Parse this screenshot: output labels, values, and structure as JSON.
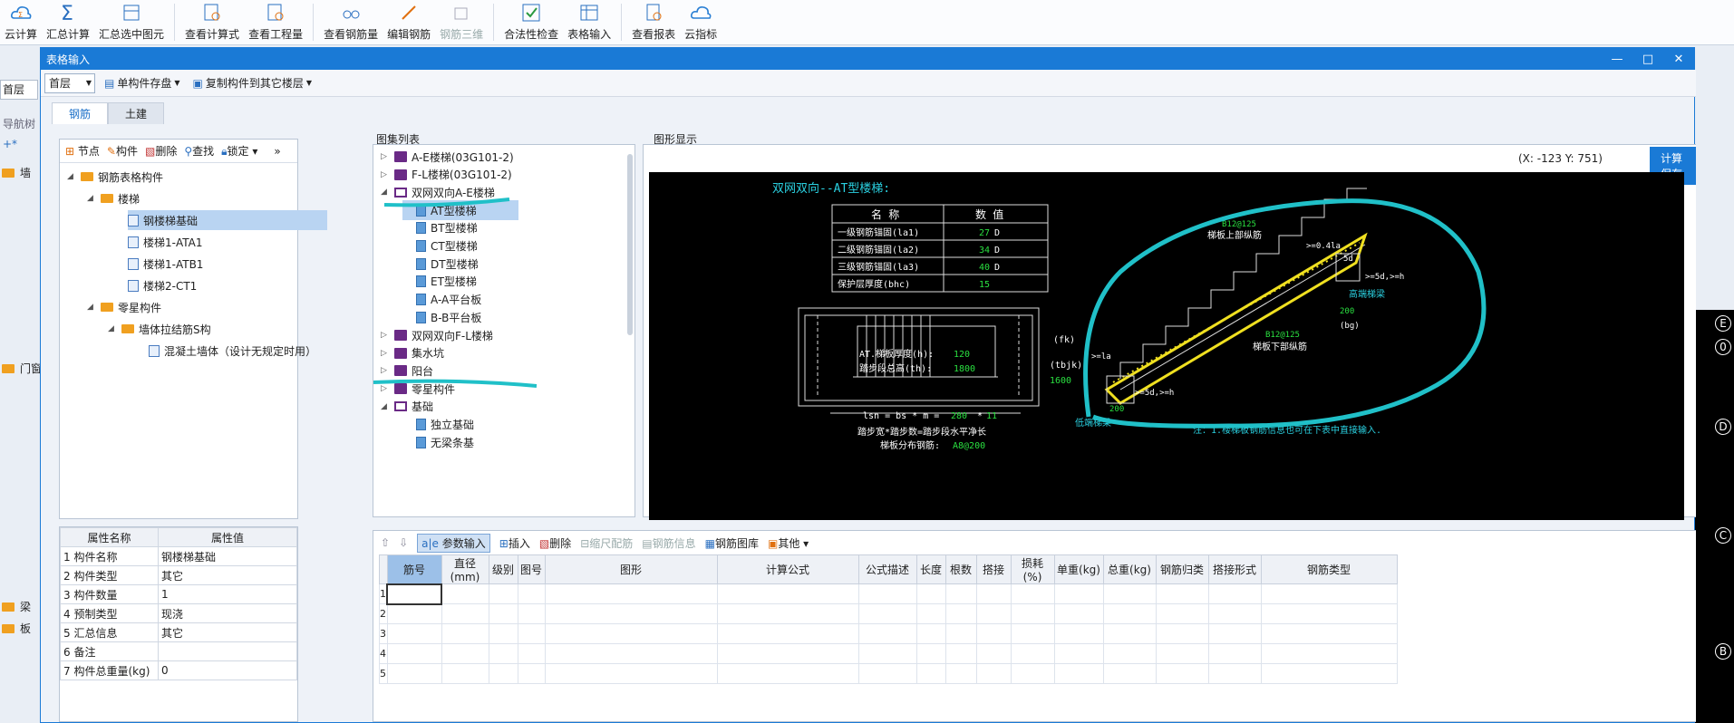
{
  "ribbon": [
    {
      "label": "云计算",
      "icon": "cloud-calc-icon"
    },
    {
      "label": "汇总计算",
      "icon": "sigma-icon"
    },
    {
      "label": "汇总选中图元",
      "icon": "sum-selected-icon"
    },
    {
      "label": "查看计算式",
      "icon": "view-formula-icon"
    },
    {
      "label": "查看工程量",
      "icon": "view-quantity-icon"
    },
    {
      "label": "查看钢筋量",
      "icon": "view-rebar-icon"
    },
    {
      "label": "编辑钢筋",
      "icon": "edit-rebar-icon"
    },
    {
      "label": "钢筋三维",
      "icon": "rebar-3d-icon"
    },
    {
      "label": "合法性检查",
      "icon": "check-icon"
    },
    {
      "label": "表格输入",
      "icon": "table-input-icon"
    },
    {
      "label": "查看报表",
      "icon": "report-icon"
    },
    {
      "label": "云指标",
      "icon": "cloud-index-icon"
    }
  ],
  "window": {
    "title": "表格输入"
  },
  "floor_outer": "首层",
  "toolbar2": {
    "floor": "首层",
    "save_single": "单构件存盘",
    "copy": "复制构件到其它楼层"
  },
  "tabs": [
    "钢筋",
    "土建"
  ],
  "leftnav": {
    "title": "导航树",
    "items": [
      "墙",
      "门窗",
      "梁",
      "板"
    ]
  },
  "treeToolbar": {
    "node": "节点",
    "component": "构件",
    "delete": "删除",
    "find": "查找",
    "lock": "锁定"
  },
  "tree": [
    "钢筋表格构件",
    "楼梯",
    "钢楼梯基础",
    "楼梯1-ATA1",
    "楼梯1-ATB1",
    "楼梯2-CT1",
    "零星构件",
    "墙体拉结筋S构",
    "混凝土墙体（设计无规定时用）"
  ],
  "props": {
    "h_name": "属性名称",
    "h_value": "属性值",
    "rows": [
      {
        "n": "1",
        "k": "构件名称",
        "v": "钢楼梯基础"
      },
      {
        "n": "2",
        "k": "构件类型",
        "v": "其它"
      },
      {
        "n": "3",
        "k": "构件数量",
        "v": "1"
      },
      {
        "n": "4",
        "k": "预制类型",
        "v": "现浇"
      },
      {
        "n": "5",
        "k": "汇总信息",
        "v": "其它"
      },
      {
        "n": "6",
        "k": "备注",
        "v": ""
      },
      {
        "n": "7",
        "k": "构件总重量(kg)",
        "v": "0"
      }
    ]
  },
  "atlas": {
    "title": "图集列表",
    "items": [
      "A-E楼梯(03G101-2)",
      "F-L楼梯(03G101-2)",
      "双网双向A-E楼梯",
      "AT型楼梯",
      "BT型楼梯",
      "CT型楼梯",
      "DT型楼梯",
      "ET型楼梯",
      "A-A平台板",
      "B-B平台板",
      "双网双向F-L楼梯",
      "集水坑",
      "阳台",
      "零星构件",
      "基础",
      "独立基础",
      "无梁条基"
    ]
  },
  "graphic": {
    "title": "图形显示",
    "coord": "(X: -123 Y: 751)",
    "save": "计算保存"
  },
  "cad": {
    "heading": "双网双向--AT型楼梯:",
    "t_h1": "名 称",
    "t_h2": "数 值",
    "rows": [
      {
        "k": "一级钢筋锚固(la1)",
        "v": "27",
        "u": "D"
      },
      {
        "k": "二级钢筋锚固(la2)",
        "v": "34",
        "u": "D"
      },
      {
        "k": "三级钢筋锚固(la3)",
        "v": "40",
        "u": "D"
      },
      {
        "k": "保护层厚度(bhc)",
        "v": "15",
        "u": ""
      }
    ],
    "thick": "AT.梯板厚度(h):",
    "thick_v": "120",
    "height": "踏步段总高(th):",
    "height_v": "1800",
    "fk": "(fk)",
    "tbjk": "(tbjk)",
    "v1600": "1600",
    "lsn": "lsn = bs * m =",
    "bs": "280",
    "m": "11",
    "steps": "踏步宽*踏步数=踏步段水平净长",
    "dist": "梯板分布钢筋:",
    "dist_v": "A8@200",
    "b1": "B12@125",
    "top": "梯板上部纵筋",
    "b2": "B12@125",
    "bot": "梯板下部纵筋",
    "high": "高端梯梁",
    "low": "低端梯梁",
    "v200a": "200",
    "v200b": "200",
    "bg": "(bg)",
    "note": "注：1.楼梯板钢筋信息也可在下表中直接输入.",
    "l1": ">=0.4la",
    "l2": "5d",
    ">5d": ">=5d,>=h",
    "l3": ">=la",
    "l4": ">=5d,>=h"
  },
  "gridTb": {
    "param": "参数输入",
    "insert": "插入",
    "delete": "删除",
    "scale": "缩尺配筋",
    "info": "钢筋信息",
    "lib": "钢筋图库",
    "other": "其他"
  },
  "gridHead": [
    "筋号",
    "直径(mm)",
    "级别",
    "图号",
    "图形",
    "计算公式",
    "公式描述",
    "长度",
    "根数",
    "搭接",
    "损耗(%)",
    "单重(kg)",
    "总重(kg)",
    "钢筋归类",
    "搭接形式",
    "钢筋类型"
  ],
  "gridRows": [
    "1",
    "2",
    "3",
    "4",
    "5"
  ],
  "axis": [
    "E",
    "0",
    "D",
    "C",
    "B"
  ]
}
